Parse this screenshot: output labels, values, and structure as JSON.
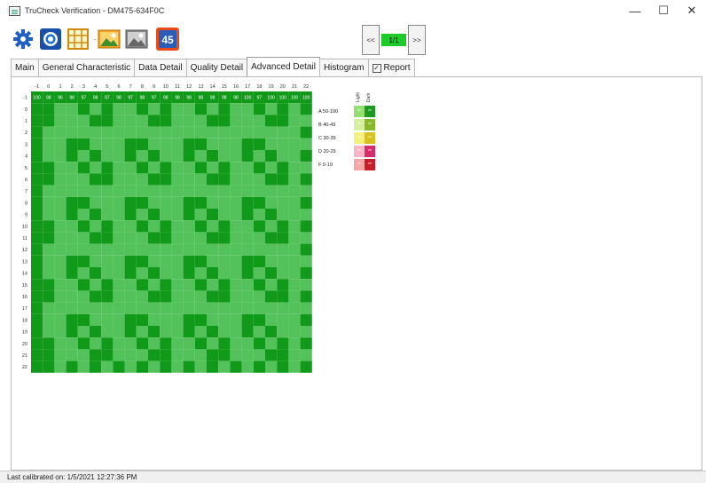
{
  "window": {
    "title": "TruCheck Verification - DM475-634F0C",
    "minimize": "—",
    "maximize": "☐",
    "close": "✕"
  },
  "toolbar": {
    "icons": [
      "gear-icon",
      "camera-icon",
      "grid-icon",
      "image-color-icon",
      "image-gray-icon",
      "calendar-45-icon"
    ],
    "calendar_badge": "45"
  },
  "navigation": {
    "prev": "<<",
    "page": "1/1",
    "next": ">>"
  },
  "tabs": [
    {
      "label": "Main"
    },
    {
      "label": "General Characteristic"
    },
    {
      "label": "Data Detail"
    },
    {
      "label": "Quality Detail"
    },
    {
      "label": "Advanced Detail",
      "active": true
    },
    {
      "label": "Histogram"
    },
    {
      "label": "Report",
      "checkbox": true,
      "checked": true
    }
  ],
  "report_check": "✓",
  "grid": {
    "column_headers": [
      "-1",
      "0",
      "1",
      "2",
      "3",
      "4",
      "5",
      "6",
      "7",
      "8",
      "9",
      "10",
      "11",
      "12",
      "13",
      "14",
      "15",
      "16",
      "17",
      "18",
      "19",
      "20",
      "21",
      "22"
    ],
    "row_headers": [
      "-1",
      "0",
      "1",
      "2",
      "3",
      "4",
      "5",
      "6",
      "7",
      "8",
      "9",
      "10",
      "11",
      "12",
      "13",
      "14",
      "15",
      "16",
      "17",
      "18",
      "19",
      "20",
      "21",
      "22"
    ],
    "top_row_values": [
      "100",
      "98",
      "96",
      "98",
      "97",
      "98",
      "97",
      "98",
      "97",
      "98",
      "97",
      "98",
      "98",
      "98",
      "98",
      "98",
      "98",
      "98",
      "100",
      "97",
      "100",
      "100",
      "100",
      "100"
    ],
    "colors": {
      "dark": "#119a1a",
      "light": "#53c25a"
    }
  },
  "legend": {
    "column_labels": [
      "Light",
      "Dark"
    ],
    "entries": [
      {
        "label": "A 50-100",
        "light": "#93df6f",
        "dark": "#1e9a22"
      },
      {
        "label": "B 40-49",
        "light": "#d6f0a0",
        "dark": "#8ab82b"
      },
      {
        "label": "C 30-39",
        "light": "#f6f07a",
        "dark": "#d8c21e"
      },
      {
        "label": "D 20-29",
        "light": "#f8b5c8",
        "dark": "#d62d6b"
      },
      {
        "label": "F 0-19",
        "light": "#f7a6a6",
        "dark": "#c81e2c"
      }
    ],
    "cell_text": "**"
  },
  "status_bar": {
    "text": "Last calibrated on: 1/5/2021 12:27:36 PM"
  }
}
